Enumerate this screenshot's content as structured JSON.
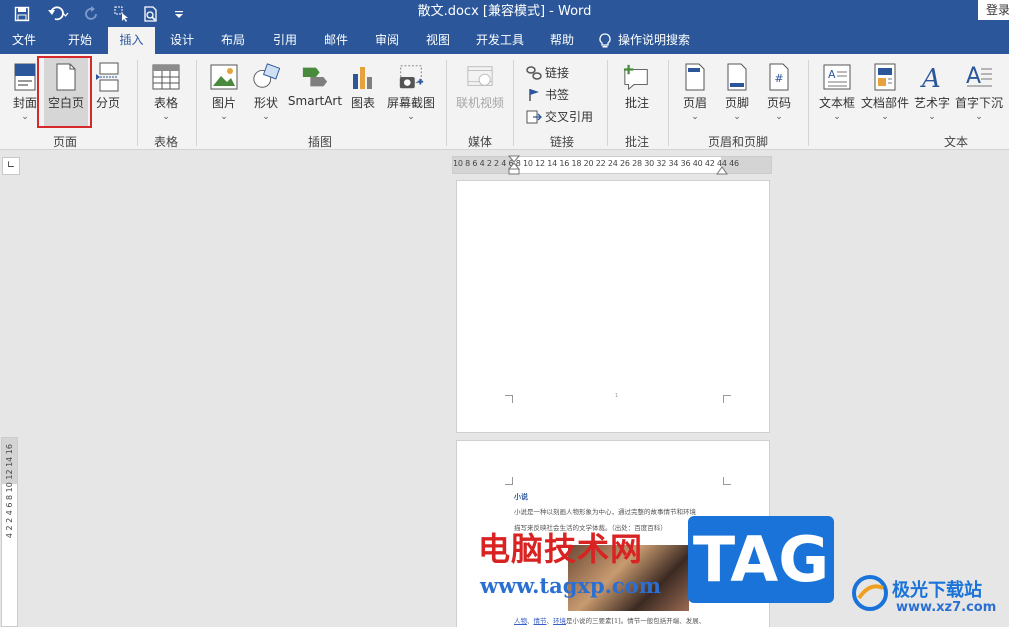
{
  "window": {
    "title": "散文.docx [兼容模式]  -  Word",
    "login": "登录"
  },
  "qat_icons": [
    "save-icon",
    "undo-icon",
    "redo-icon",
    "touch-mode-icon",
    "print-preview-icon",
    "customize-qat-icon"
  ],
  "menu": {
    "tabs": [
      "文件",
      "开始",
      "插入",
      "设计",
      "布局",
      "引用",
      "邮件",
      "审阅",
      "视图",
      "开发工具",
      "帮助"
    ],
    "active": "插入",
    "tell_me": "操作说明搜索"
  },
  "ribbon": {
    "pages": {
      "cover": "封面",
      "blank": "空白页",
      "break": "分页",
      "group": "页面"
    },
    "tables": {
      "table": "表格",
      "group": "表格"
    },
    "illustrations": {
      "pictures": "图片",
      "shapes": "形状",
      "smartart": "SmartArt",
      "chart": "图表",
      "screenshot": "屏幕截图",
      "group": "插图"
    },
    "media": {
      "online_video": "联机视频",
      "group": "媒体"
    },
    "links": {
      "link": "链接",
      "bookmark": "书签",
      "cross_ref": "交叉引用",
      "group": "链接"
    },
    "comments": {
      "comment": "批注",
      "group": "批注"
    },
    "header_footer": {
      "header": "页眉",
      "footer": "页脚",
      "page_number": "页码",
      "group": "页眉和页脚"
    },
    "text": {
      "textbox": "文本框",
      "quick_parts": "文档部件",
      "wordart": "艺术字",
      "dropcap": "首字下沉",
      "group": "文本"
    }
  },
  "ruler": {
    "horizontal": "10 8 6 4 2     2  4  6  8 10 12 14 16 18 20 22 24 26 28 30 32 34 36     40 42 44 46",
    "vertical": "4  2      2  4  6  8  10 12 14 16"
  },
  "document": {
    "page1_marker": "1",
    "heading": "小说",
    "line1": "小说是一种以刻画人物形象为中心，通过完整的故事情节和环境",
    "line2": "描写来反映社会生活的文学体裁。（出处：百度百科）",
    "bottom_links": [
      "人物",
      "情节",
      "环境"
    ],
    "bottom_rest": "是小说的三要素[1]。情节一般包括开端、发展、"
  },
  "watermark": {
    "cn": "电脑技术网",
    "url": "www.tagxp.com",
    "tag": "TAG",
    "brand": "极光下载站",
    "brand_url": "www.xz7.com"
  }
}
